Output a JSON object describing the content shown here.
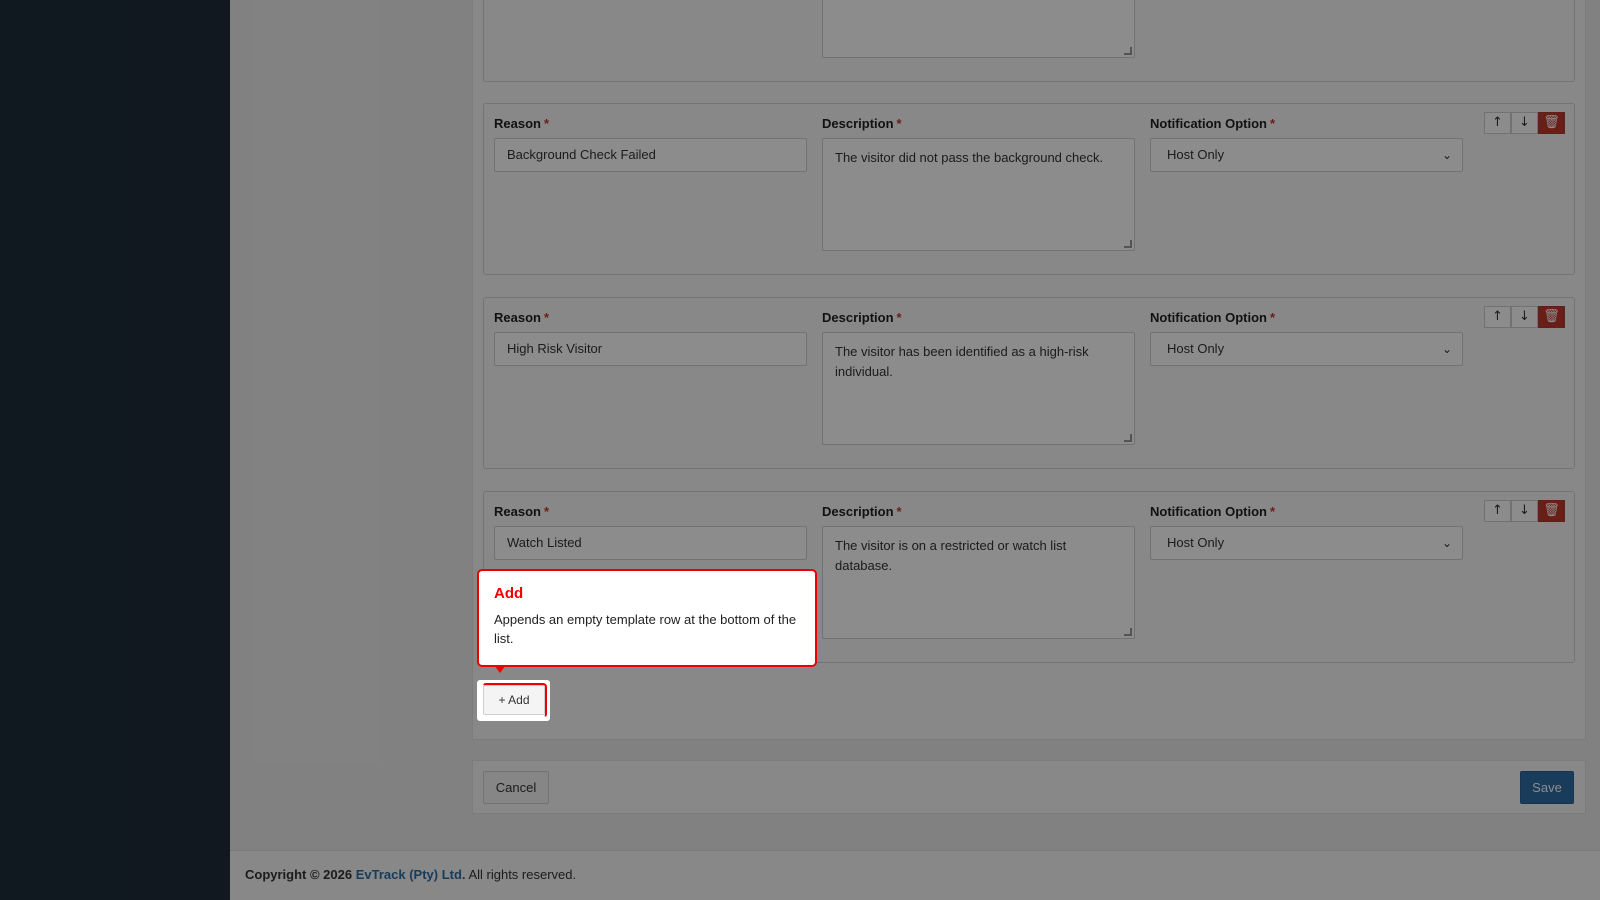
{
  "rows": [
    {
      "reason_label": "Reason",
      "reason_value": "Background Check Failed",
      "description_label": "Description",
      "description_value": "The visitor did not pass the background check.",
      "notification_label": "Notification Option",
      "notification_value": "Host Only"
    },
    {
      "reason_label": "Reason",
      "reason_value": "High Risk Visitor",
      "description_label": "Description",
      "description_value": "The visitor has been identified as a high-risk individual.",
      "notification_label": "Notification Option",
      "notification_value": "Host Only"
    },
    {
      "reason_label": "Reason",
      "reason_value": "Watch Listed",
      "description_label": "Description",
      "description_value": "The visitor is on a restricted or watch list database.",
      "notification_label": "Notification Option",
      "notification_value": "Host Only"
    }
  ],
  "required_mark": "*",
  "row_actions": {
    "up": "↑",
    "down": "↓",
    "delete": "🗑"
  },
  "add_button": {
    "icon": "+",
    "label": "Add"
  },
  "tooltip": {
    "title": "Add",
    "body": "Appends an empty template row at the bottom of the list."
  },
  "footer": {
    "cancel_label": "Cancel",
    "save_label": "Save"
  },
  "copyright": {
    "prefix": "Copyright © 2026",
    "brand": "EvTrack (Pty) Ltd.",
    "suffix": "All rights reserved."
  },
  "chevron": "⌄",
  "colors": {
    "accent": "#2e6da4",
    "danger": "#c0392b",
    "highlight": "#ee0000"
  }
}
